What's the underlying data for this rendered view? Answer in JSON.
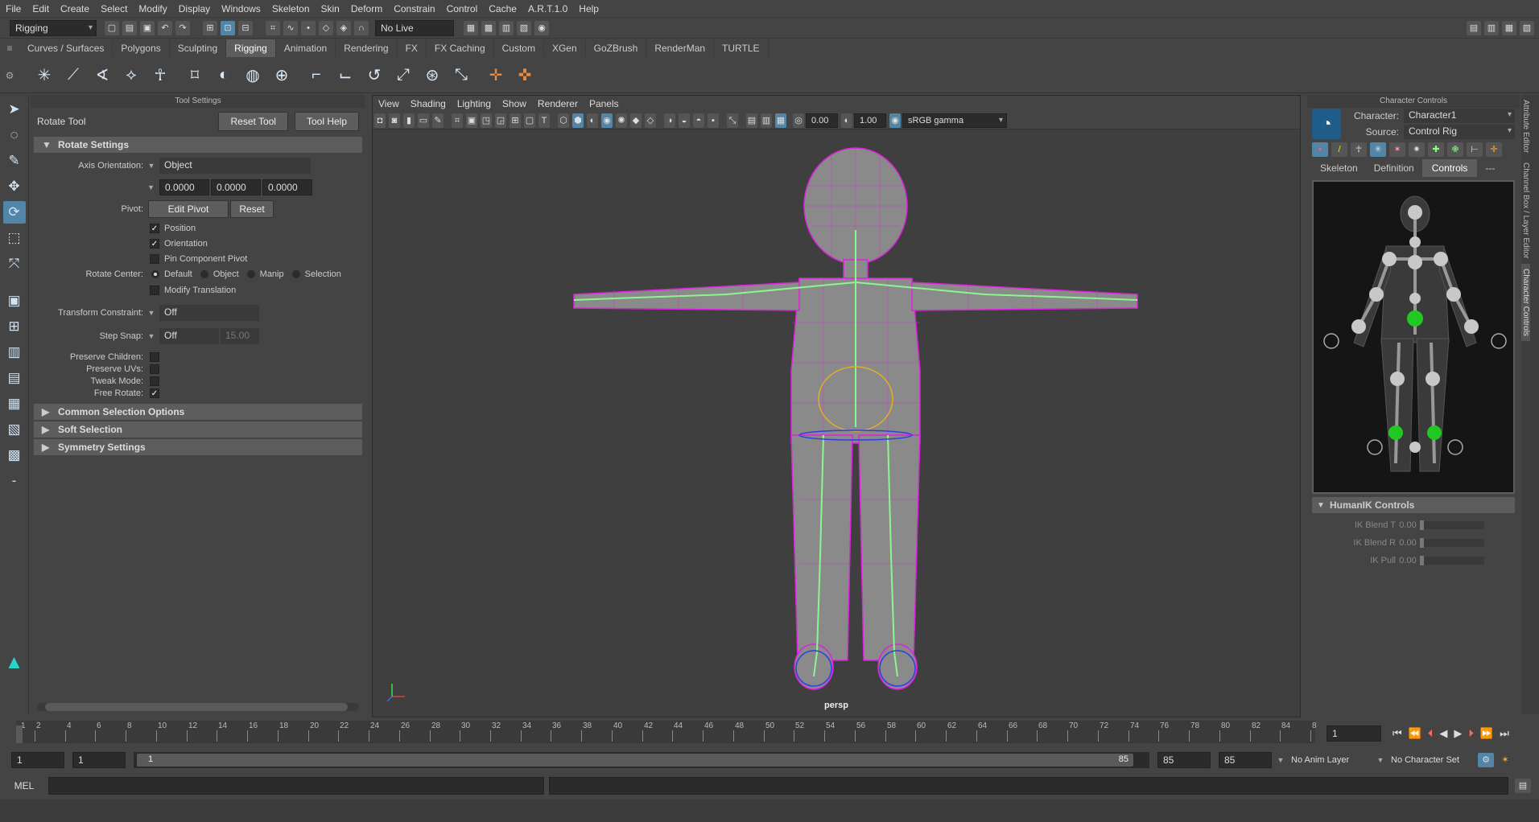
{
  "menus": [
    "File",
    "Edit",
    "Create",
    "Select",
    "Modify",
    "Display",
    "Windows",
    "Skeleton",
    "Skin",
    "Deform",
    "Constrain",
    "Control",
    "Cache",
    "A.R.T.1.0",
    "Help"
  ],
  "status": {
    "mode": "Rigging",
    "live_surface": "No Live Surface",
    "exposure": "0.00",
    "gamma": "1.00",
    "colorspace": "sRGB gamma"
  },
  "shelf_tabs": [
    "Curves / Surfaces",
    "Polygons",
    "Sculpting",
    "Rigging",
    "Animation",
    "Rendering",
    "FX",
    "FX Caching",
    "Custom",
    "XGen",
    "GoZBrush",
    "RenderMan",
    "TURTLE"
  ],
  "active_shelf": "Rigging",
  "tool_settings": {
    "panel_title": "Tool Settings",
    "tool_name": "Rotate Tool",
    "reset_btn": "Reset Tool",
    "help_btn": "Tool Help",
    "rotate_section": "Rotate Settings",
    "axis_label": "Axis Orientation:",
    "axis_value": "Object",
    "rot_x": "0.0000",
    "rot_y": "0.0000",
    "rot_z": "0.0000",
    "pivot_label": "Pivot:",
    "edit_pivot": "Edit Pivot",
    "reset": "Reset",
    "position": "Position",
    "orientation": "Orientation",
    "pin_component": "Pin Component Pivot",
    "rotate_center_label": "Rotate Center:",
    "rc_default": "Default",
    "rc_object": "Object",
    "rc_manip": "Manip",
    "rc_selection": "Selection",
    "modify_translation": "Modify Translation",
    "transform_constraint_label": "Transform Constraint:",
    "transform_constraint_value": "Off",
    "step_snap_label": "Step Snap:",
    "step_snap_value": "Off",
    "step_snap_num": "15.00",
    "preserve_children": "Preserve Children:",
    "preserve_uvs": "Preserve UVs:",
    "tweak_mode": "Tweak Mode:",
    "free_rotate": "Free Rotate:",
    "common_selection": "Common Selection Options",
    "soft_selection": "Soft Selection",
    "symmetry": "Symmetry Settings"
  },
  "viewport": {
    "menus": [
      "View",
      "Shading",
      "Lighting",
      "Show",
      "Renderer",
      "Panels"
    ],
    "camera_label": "persp"
  },
  "character_controls": {
    "panel_title": "Character Controls",
    "character_label": "Character:",
    "character_value": "Character1",
    "source_label": "Source:",
    "source_value": "Control Rig",
    "tabs": [
      "Skeleton",
      "Definition",
      "Controls",
      "---"
    ],
    "active_tab": "Controls",
    "humanik_section": "HumanIK Controls",
    "ik_blend_t": "IK Blend T",
    "ik_blend_t_val": "0.00",
    "ik_blend_r": "IK Blend R",
    "ik_blend_r_val": "0.00",
    "ik_pull": "IK Pull",
    "ik_pull_val": "0.00"
  },
  "right_tabs": [
    "Attribute Editor",
    "Channel Box / Layer Editor",
    "Character Controls"
  ],
  "timeline": {
    "ticks": [
      "1",
      "2",
      "4",
      "6",
      "8",
      "10",
      "12",
      "14",
      "16",
      "18",
      "20",
      "22",
      "24",
      "26",
      "28",
      "30",
      "32",
      "34",
      "36",
      "38",
      "40",
      "42",
      "44",
      "46",
      "48",
      "50",
      "52",
      "54",
      "56",
      "58",
      "60",
      "62",
      "64",
      "66",
      "68",
      "70",
      "72",
      "74",
      "76",
      "78",
      "80",
      "82",
      "84",
      "8"
    ],
    "current_frame": "1"
  },
  "range": {
    "start": "1",
    "inner_start": "1",
    "slider_start": "1",
    "slider_end": "85",
    "end": "85",
    "outer_end": "85",
    "anim_layer": "No Anim Layer",
    "char_set": "No Character Set"
  },
  "cmd": {
    "lang": "MEL"
  },
  "colors": {
    "accent": "#5285a6",
    "mesh": "#e020e0",
    "joint": "#8ef58e"
  }
}
